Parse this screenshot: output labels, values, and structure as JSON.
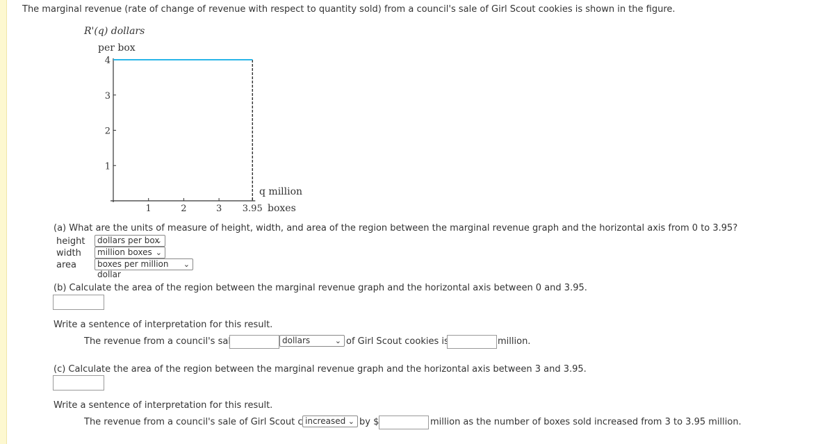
{
  "question": "The marginal revenue (rate of change of revenue with respect to quantity sold) from a council's sale of Girl Scout cookies is shown in the figure.",
  "chart_data": {
    "type": "line",
    "ylabel_line1": "R'(q) dollars",
    "ylabel_line2": "per box",
    "xlabel_line1": "q million",
    "xlabel_line2": "boxes",
    "x_ticks": [
      "1",
      "2",
      "3",
      "3.95"
    ],
    "x_tick_values": [
      1,
      2,
      3,
      3.95
    ],
    "y_ticks": [
      "1",
      "2",
      "3",
      "4"
    ],
    "y_tick_values": [
      1,
      2,
      3,
      4
    ],
    "xlim": [
      0,
      3.95
    ],
    "ylim": [
      0,
      4
    ],
    "series": [
      {
        "x": [
          0,
          3.95
        ],
        "y": [
          4,
          4
        ],
        "color": "#29b6e8"
      }
    ],
    "vertical_dashed_line_x": 3.95,
    "grid": false
  },
  "part_a": {
    "prompt": "(a) What are the units of measure of height, width, and area of the region between the marginal revenue graph and the horizontal axis from 0 to 3.95?",
    "rows": [
      {
        "label": "height",
        "value": "dollars per box"
      },
      {
        "label": "width",
        "value": "million boxes"
      },
      {
        "label": "area",
        "value": "boxes per million dollar"
      }
    ]
  },
  "part_b": {
    "prompt": "(b) Calculate the area of the region between the marginal revenue graph and the horizontal axis between 0 and 3.95.",
    "answer": "",
    "interp_prompt": "Write a sentence of interpretation for this result.",
    "s1": "The revenue from a council's sale of",
    "blank1": "",
    "unit_select": "dollars",
    "s2": "of Girl Scout cookies is $",
    "blank2": "",
    "s3": "million."
  },
  "part_c": {
    "prompt": "(c) Calculate the area of the region between the marginal revenue graph and the horizontal axis between 3 and 3.95.",
    "answer": "",
    "interp_prompt": "Write a sentence of interpretation for this result.",
    "s1": "The revenue from a council's sale of Girl Scout cookies",
    "direction_select": "increased",
    "s2": "by $",
    "blank": "",
    "s3": "million as the number of boxes sold increased from 3 to 3.95 million."
  }
}
